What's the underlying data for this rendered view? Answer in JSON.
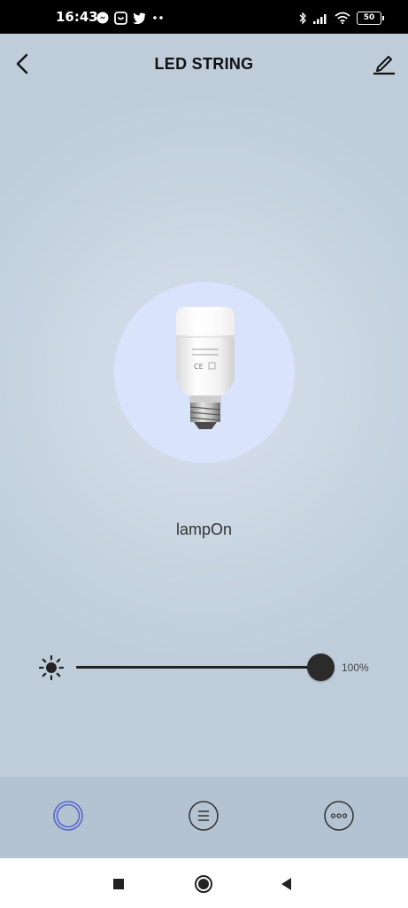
{
  "status_bar": {
    "time": "16:43",
    "battery": "50",
    "left_icons": [
      "messenger-icon",
      "notification-icon",
      "twitter-icon",
      "more-dots-icon"
    ],
    "right_icons": [
      "bluetooth-icon",
      "signal-icon",
      "wifi-icon",
      "battery-icon"
    ]
  },
  "header": {
    "title": "LED STRING",
    "back_icon": "chevron-left-icon",
    "edit_icon": "pencil-icon"
  },
  "device": {
    "name": "lampOn",
    "image": "light-bulb",
    "glow_color": "#d9e3fb"
  },
  "brightness": {
    "icon": "sun-icon",
    "value": 1.0,
    "label": "100%"
  },
  "tabs": [
    {
      "icon": "power-ring-icon",
      "active": true,
      "color": "#5566cc"
    },
    {
      "icon": "list-icon",
      "active": false,
      "color": "#333333"
    },
    {
      "icon": "more-icon",
      "active": false,
      "color": "#333333"
    }
  ],
  "system_nav": [
    "recents-button",
    "home-button",
    "back-button"
  ]
}
